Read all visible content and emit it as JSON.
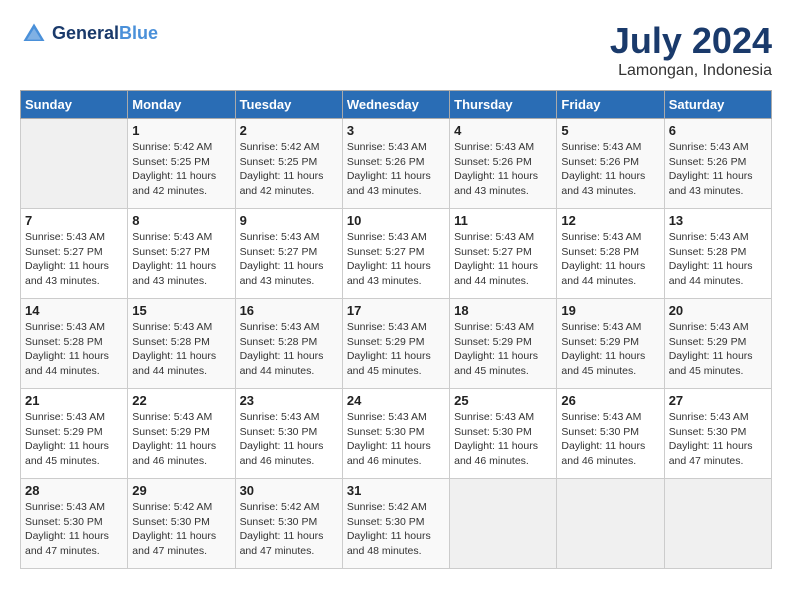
{
  "header": {
    "logo_line1": "General",
    "logo_line2": "Blue",
    "month_year": "July 2024",
    "location": "Lamongan, Indonesia"
  },
  "days_of_week": [
    "Sunday",
    "Monday",
    "Tuesday",
    "Wednesday",
    "Thursday",
    "Friday",
    "Saturday"
  ],
  "weeks": [
    [
      {
        "day": "",
        "info": ""
      },
      {
        "day": "1",
        "info": "Sunrise: 5:42 AM\nSunset: 5:25 PM\nDaylight: 11 hours\nand 42 minutes."
      },
      {
        "day": "2",
        "info": "Sunrise: 5:42 AM\nSunset: 5:25 PM\nDaylight: 11 hours\nand 42 minutes."
      },
      {
        "day": "3",
        "info": "Sunrise: 5:43 AM\nSunset: 5:26 PM\nDaylight: 11 hours\nand 43 minutes."
      },
      {
        "day": "4",
        "info": "Sunrise: 5:43 AM\nSunset: 5:26 PM\nDaylight: 11 hours\nand 43 minutes."
      },
      {
        "day": "5",
        "info": "Sunrise: 5:43 AM\nSunset: 5:26 PM\nDaylight: 11 hours\nand 43 minutes."
      },
      {
        "day": "6",
        "info": "Sunrise: 5:43 AM\nSunset: 5:26 PM\nDaylight: 11 hours\nand 43 minutes."
      }
    ],
    [
      {
        "day": "7",
        "info": "Sunrise: 5:43 AM\nSunset: 5:27 PM\nDaylight: 11 hours\nand 43 minutes."
      },
      {
        "day": "8",
        "info": "Sunrise: 5:43 AM\nSunset: 5:27 PM\nDaylight: 11 hours\nand 43 minutes."
      },
      {
        "day": "9",
        "info": "Sunrise: 5:43 AM\nSunset: 5:27 PM\nDaylight: 11 hours\nand 43 minutes."
      },
      {
        "day": "10",
        "info": "Sunrise: 5:43 AM\nSunset: 5:27 PM\nDaylight: 11 hours\nand 43 minutes."
      },
      {
        "day": "11",
        "info": "Sunrise: 5:43 AM\nSunset: 5:27 PM\nDaylight: 11 hours\nand 44 minutes."
      },
      {
        "day": "12",
        "info": "Sunrise: 5:43 AM\nSunset: 5:28 PM\nDaylight: 11 hours\nand 44 minutes."
      },
      {
        "day": "13",
        "info": "Sunrise: 5:43 AM\nSunset: 5:28 PM\nDaylight: 11 hours\nand 44 minutes."
      }
    ],
    [
      {
        "day": "14",
        "info": "Sunrise: 5:43 AM\nSunset: 5:28 PM\nDaylight: 11 hours\nand 44 minutes."
      },
      {
        "day": "15",
        "info": "Sunrise: 5:43 AM\nSunset: 5:28 PM\nDaylight: 11 hours\nand 44 minutes."
      },
      {
        "day": "16",
        "info": "Sunrise: 5:43 AM\nSunset: 5:28 PM\nDaylight: 11 hours\nand 44 minutes."
      },
      {
        "day": "17",
        "info": "Sunrise: 5:43 AM\nSunset: 5:29 PM\nDaylight: 11 hours\nand 45 minutes."
      },
      {
        "day": "18",
        "info": "Sunrise: 5:43 AM\nSunset: 5:29 PM\nDaylight: 11 hours\nand 45 minutes."
      },
      {
        "day": "19",
        "info": "Sunrise: 5:43 AM\nSunset: 5:29 PM\nDaylight: 11 hours\nand 45 minutes."
      },
      {
        "day": "20",
        "info": "Sunrise: 5:43 AM\nSunset: 5:29 PM\nDaylight: 11 hours\nand 45 minutes."
      }
    ],
    [
      {
        "day": "21",
        "info": "Sunrise: 5:43 AM\nSunset: 5:29 PM\nDaylight: 11 hours\nand 45 minutes."
      },
      {
        "day": "22",
        "info": "Sunrise: 5:43 AM\nSunset: 5:29 PM\nDaylight: 11 hours\nand 46 minutes."
      },
      {
        "day": "23",
        "info": "Sunrise: 5:43 AM\nSunset: 5:30 PM\nDaylight: 11 hours\nand 46 minutes."
      },
      {
        "day": "24",
        "info": "Sunrise: 5:43 AM\nSunset: 5:30 PM\nDaylight: 11 hours\nand 46 minutes."
      },
      {
        "day": "25",
        "info": "Sunrise: 5:43 AM\nSunset: 5:30 PM\nDaylight: 11 hours\nand 46 minutes."
      },
      {
        "day": "26",
        "info": "Sunrise: 5:43 AM\nSunset: 5:30 PM\nDaylight: 11 hours\nand 46 minutes."
      },
      {
        "day": "27",
        "info": "Sunrise: 5:43 AM\nSunset: 5:30 PM\nDaylight: 11 hours\nand 47 minutes."
      }
    ],
    [
      {
        "day": "28",
        "info": "Sunrise: 5:43 AM\nSunset: 5:30 PM\nDaylight: 11 hours\nand 47 minutes."
      },
      {
        "day": "29",
        "info": "Sunrise: 5:42 AM\nSunset: 5:30 PM\nDaylight: 11 hours\nand 47 minutes."
      },
      {
        "day": "30",
        "info": "Sunrise: 5:42 AM\nSunset: 5:30 PM\nDaylight: 11 hours\nand 47 minutes."
      },
      {
        "day": "31",
        "info": "Sunrise: 5:42 AM\nSunset: 5:30 PM\nDaylight: 11 hours\nand 48 minutes."
      },
      {
        "day": "",
        "info": ""
      },
      {
        "day": "",
        "info": ""
      },
      {
        "day": "",
        "info": ""
      }
    ]
  ]
}
